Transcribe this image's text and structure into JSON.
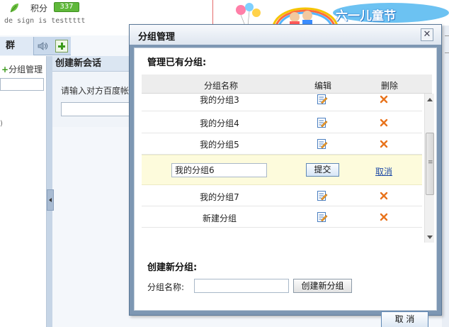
{
  "header": {
    "score_label": "积分",
    "score_value": "337",
    "signature": "de sign is testtttt",
    "banner_text": "六一儿童节"
  },
  "tabs": {
    "group_tab": "群",
    "speaker_icon": "speaker-icon",
    "add_icon": "plus-icon"
  },
  "left_panel": {
    "group_mgmt_plus": "+",
    "group_mgmt_label": "分组管理",
    "paren": ")"
  },
  "new_chat": {
    "title": "创建新会话",
    "hint": "请输入对方百度帐"
  },
  "dialog": {
    "title": "分组管理",
    "close_glyph": "✕",
    "existing_title": "管理已有分组:",
    "columns": {
      "name": "分组名称",
      "edit": "编辑",
      "delete": "删除"
    },
    "groups": [
      {
        "name": "我的分组3"
      },
      {
        "name": "我的分组4"
      },
      {
        "name": "我的分组5"
      },
      {
        "name": "我的分组6",
        "editing": true
      },
      {
        "name": "我的分组7"
      },
      {
        "name": "新建分组"
      }
    ],
    "edit_row": {
      "input_value": "我的分组6",
      "submit_label": "提交",
      "cancel_label": "取消"
    },
    "icons": {
      "edit": "edit-icon",
      "delete": "delete-icon"
    },
    "create_title": "创建新分组:",
    "create_label": "分组名称:",
    "create_input_value": "",
    "create_button": "创建新分组",
    "cancel_button": "取 消"
  },
  "colors": {
    "accent_green": "#5fb83a",
    "dialog_frame": "#7d97b3",
    "delete_orange": "#e8731c",
    "link_blue": "#1e4aa6",
    "editing_row_bg": "#fdfbdc"
  }
}
